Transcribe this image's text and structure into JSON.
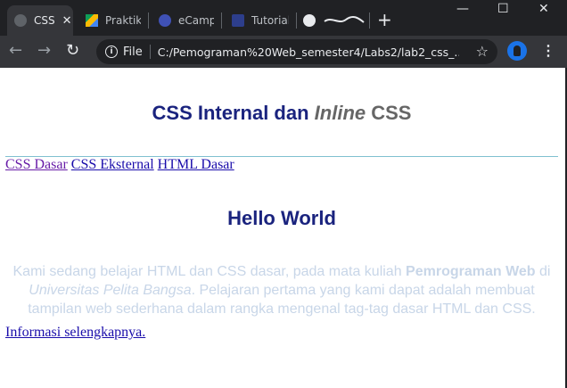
{
  "browser": {
    "tabs": [
      {
        "title": "CSS",
        "active": true
      },
      {
        "title": "Praktiku",
        "active": false
      },
      {
        "title": "eCampu",
        "active": false
      },
      {
        "title": "Tutorial",
        "active": false
      },
      {
        "title": "",
        "active": false
      }
    ],
    "close_glyph": "✕",
    "new_tab_glyph": "+",
    "window_controls": {
      "minimize": "—",
      "maximize": "☐",
      "close": "✕"
    },
    "nav": {
      "back": "←",
      "forward": "→",
      "reload": "↻"
    },
    "address": {
      "scheme": "File",
      "info_glyph": "i",
      "url": "C:/Pemograman%20Web_semester4/Labs2/lab2_css_...",
      "star": "☆"
    },
    "menu_glyph": "⋮"
  },
  "page": {
    "title_part1": "CSS Internal dan ",
    "title_italic": "Inline",
    "title_part3": " CSS",
    "nav_links": [
      "CSS Dasar",
      "CSS Eksternal",
      "HTML Dasar"
    ],
    "heading": "Hello World",
    "paragraph": {
      "text1": "Kami sedang belajar HTML dan CSS dasar, pada mata kuliah ",
      "bold": "Pemrograman Web",
      "text2": " di ",
      "italic": "Universitas Pelita Bangsa",
      "text3": ". Pelajaran pertama yang kami dapat adalah membuat tampilan web sederhana dalam rangka mengenal tag-tag dasar HTML dan CSS."
    },
    "more_link": "Informasi selengkapnya."
  },
  "colors": {
    "heading": "#1a237e",
    "grey_text": "#666666",
    "paragraph": "#c8d6e8",
    "link": "#1a0dab",
    "visited_link": "#681da8"
  }
}
